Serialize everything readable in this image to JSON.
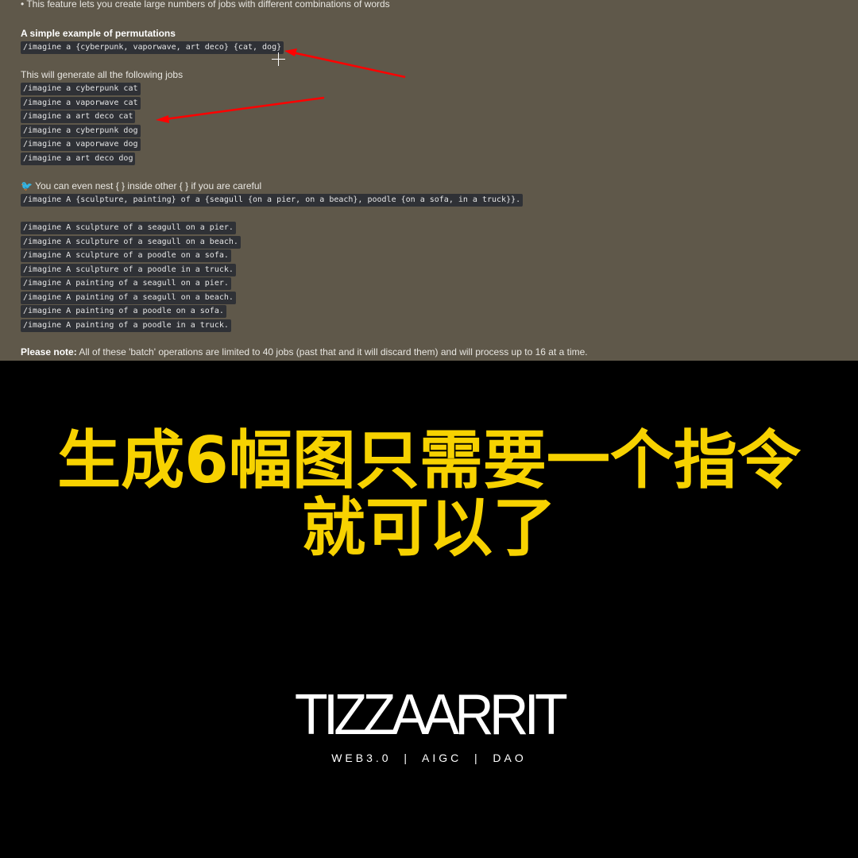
{
  "doc": {
    "bullet": "This feature lets you create large numbers of jobs with different combinations of words",
    "heading": "A simple example of permutations",
    "example": "/imagine a {cyberpunk, vaporwave, art deco} {cat, dog}",
    "generate_text": "This will generate all the following jobs",
    "jobs": [
      "/imagine a cyberpunk cat",
      "/imagine a vaporwave cat",
      "/imagine a art deco cat",
      "/imagine a cyberpunk dog",
      "/imagine a vaporwave dog",
      "/imagine a art deco dog"
    ],
    "nest_text": "You can even nest { } inside other { } if you are careful",
    "nest_example": "/imagine A {sculpture, painting} of a {seagull {on a pier, on a beach}, poodle {on a sofa, in a truck}}.",
    "nest_jobs": [
      "/imagine A sculpture of a seagull on a pier.",
      "/imagine A sculpture of a seagull on a beach.",
      "/imagine A sculpture of a poodle on a sofa.",
      "/imagine A sculpture of a poodle in a truck.",
      "/imagine A painting of a seagull on a pier.",
      "/imagine A painting of a seagull on a beach.",
      "/imagine A painting of a poodle on a sofa.",
      "/imagine A painting of a poodle in a truck."
    ],
    "note_label": "Please note:",
    "note_text": " All of these 'batch' operations are limited to 40 jobs (past that and it will discard them) and will process up to 16 at a time."
  },
  "caption": {
    "line1": "生成6幅图只需要一个指令",
    "line2": "就可以了",
    "color": "#f7d200"
  },
  "logo": {
    "text": "TIZZAARRIT",
    "tagline": "WEB3.0  |  AIGC  |  DAO"
  },
  "icons": {
    "bird": "red-bird-emoji",
    "cursor": "crosshair-cursor",
    "annotation": "red-arrow"
  }
}
